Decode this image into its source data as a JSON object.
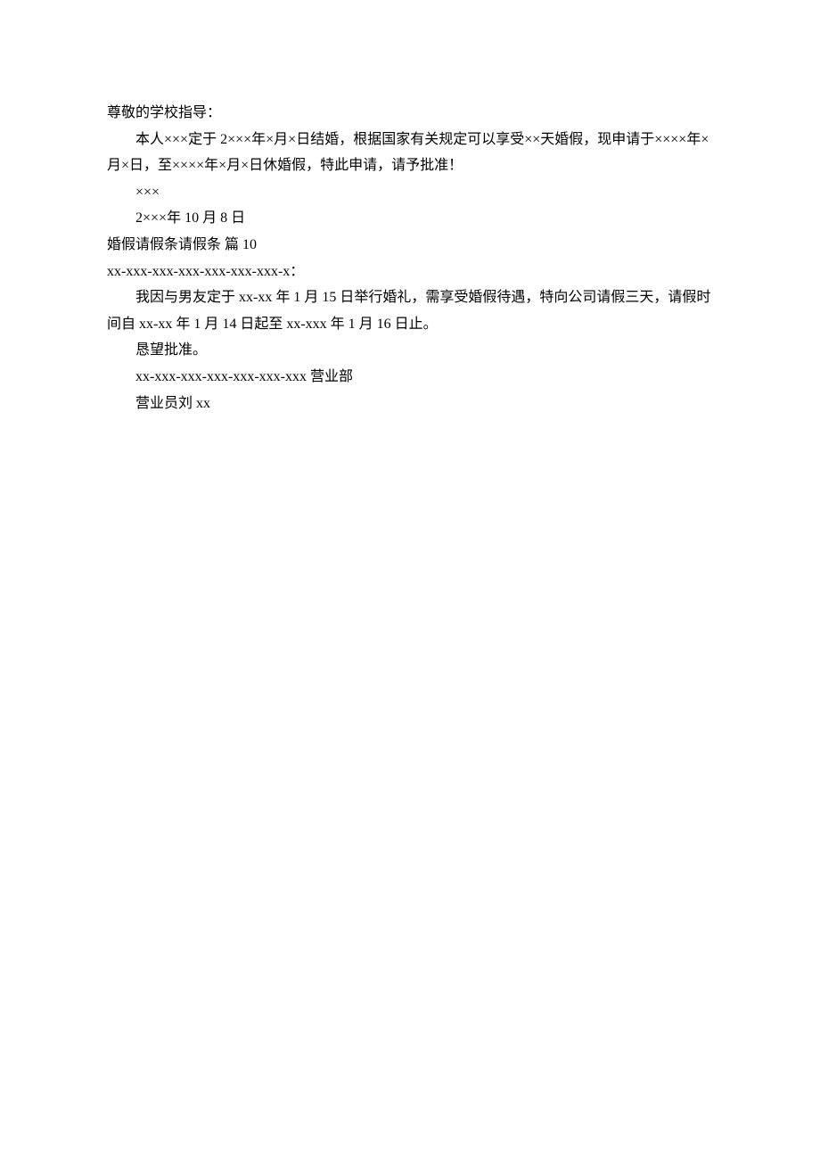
{
  "section9": {
    "salutation": "尊敬的学校指导：",
    "body": "本人×××定于 2×××年×月×日结婚，根据国家有关规定可以享受××天婚假，现申请于××××年×月×日，至××××年×月×日休婚假，特此申请，请予批准！",
    "signature": "×××",
    "date": "2×××年 10 月 8 日"
  },
  "section10": {
    "heading": "婚假请假条请假条  篇 10",
    "salutation": "xx-xxx-xxx-xxx-xxx-xxx-xxx-x：",
    "body": "我因与男友定于 xx-xx 年 1 月 15 日举行婚礼，需享受婚假待遇，特向公司请假三天，请假时间自 xx-xx 年 1 月 14 日起至 xx-xxx 年 1 月 16 日止。",
    "closing": "恳望批准。",
    "department": "xx-xxx-xxx-xxx-xxx-xxx-xxx 营业部",
    "signature": "营业员刘 xx"
  }
}
